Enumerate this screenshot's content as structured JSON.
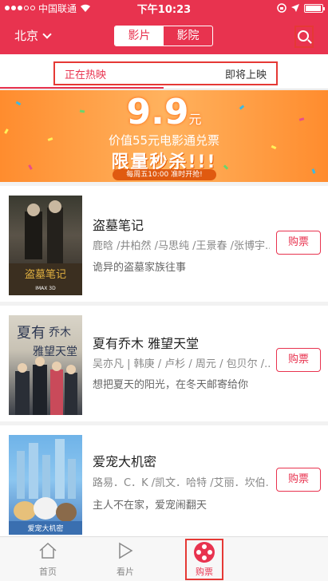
{
  "status_bar": {
    "carrier": "中国联通",
    "time": "下午10:23"
  },
  "header": {
    "city": "北京",
    "segments": [
      "影片",
      "影院"
    ],
    "active_segment": "影片"
  },
  "tabs": {
    "items": [
      "正在热映",
      "即将上映"
    ],
    "active": "正在热映"
  },
  "banner": {
    "price": "9.9",
    "price_unit": "元",
    "subtitle": "价值55元电影通兑票",
    "title": "限量秒杀!!!",
    "note": "每周五10:00 准时开抢!"
  },
  "movies": [
    {
      "title": "盗墓笔记",
      "cast": "鹿晗 /井柏然 /马思纯 /王景春 /张博宇...",
      "desc": "诡异的盗墓家族往事",
      "buy_label": "购票",
      "poster_icon": "poster-daomubiji"
    },
    {
      "title": "夏有乔木 雅望天堂",
      "cast": "吴亦凡 | 韩庚 / 卢杉 / 周元 / 包贝尔 /...",
      "desc": "想把夏天的阳光，在冬天邮寄给你",
      "buy_label": "购票",
      "poster_icon": "poster-xiayouqiaomu"
    },
    {
      "title": "爱宠大机密",
      "cast": "路易．C．K /凯文．哈特 /艾丽．坎伯...",
      "desc": "主人不在家，爱宠闹翻天",
      "buy_label": "购票",
      "poster_icon": "poster-aichongdajimi"
    }
  ],
  "bottom_nav": {
    "items": [
      {
        "label": "首页",
        "icon": "home-icon"
      },
      {
        "label": "看片",
        "icon": "play-icon"
      },
      {
        "label": "购票",
        "icon": "film-reel-icon"
      }
    ],
    "active": "购票"
  },
  "colors": {
    "brand": "#e8334f",
    "highlight_box": "#e53935",
    "banner": "#ff9a3c"
  }
}
